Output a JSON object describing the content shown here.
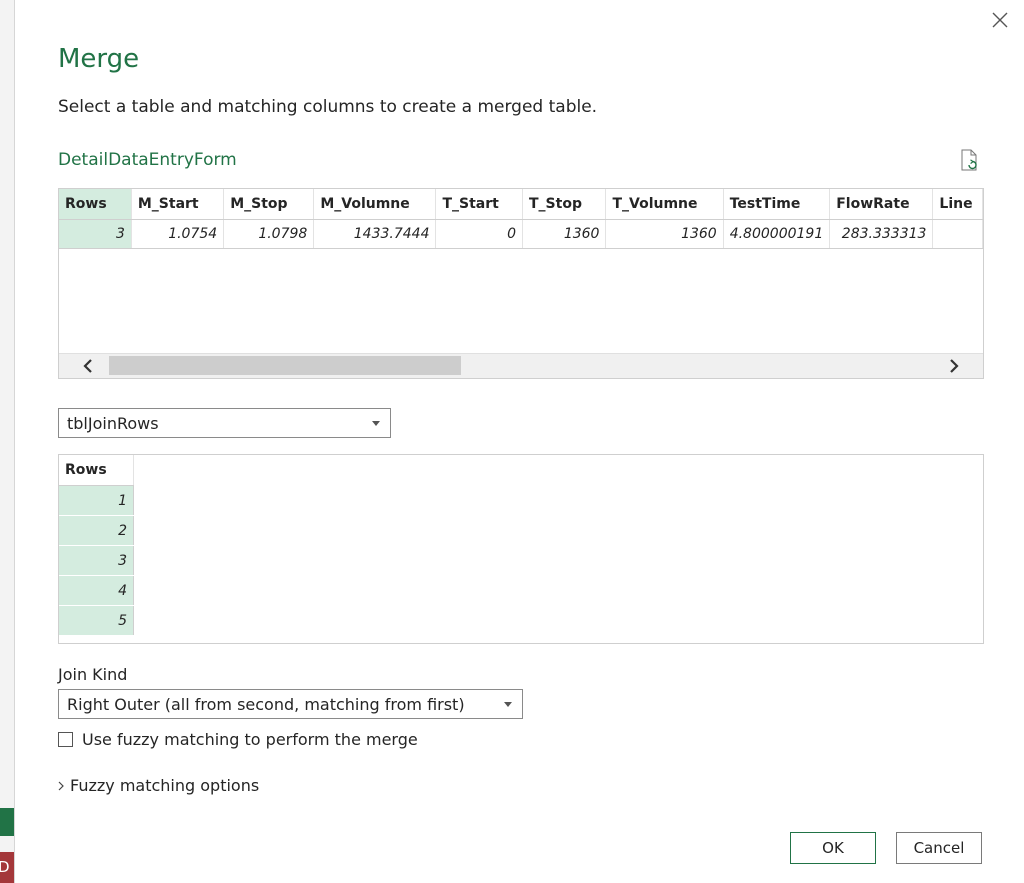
{
  "background": {
    "side_tab_text": "D"
  },
  "dialog": {
    "title": "Merge",
    "subtitle": "Select a table and matching columns to create a merged table.",
    "close_icon": "close-icon",
    "accent_color": "#217346"
  },
  "table1": {
    "name": "DetailDataEntryForm",
    "refresh_icon": "refresh-preview-icon",
    "columns": [
      "Rows",
      "M_Start",
      "M_Stop",
      "M_Volumne",
      "T_Start",
      "T_Stop",
      "T_Volumne",
      "TestTime",
      "FlowRate",
      "Line"
    ],
    "rows": [
      [
        "3",
        "1.0754",
        "1.0798",
        "1433.7444",
        "0",
        "1360",
        "1360",
        "4.800000191",
        "283.333313",
        ""
      ]
    ]
  },
  "table2": {
    "selected": "tblJoinRows",
    "columns": [
      "Rows"
    ],
    "rows": [
      [
        "1"
      ],
      [
        "2"
      ],
      [
        "3"
      ],
      [
        "4"
      ],
      [
        "5"
      ]
    ]
  },
  "join": {
    "label": "Join Kind",
    "selected": "Right Outer (all from second, matching from first)"
  },
  "fuzzy": {
    "checkbox_label": "Use fuzzy matching to perform the merge",
    "checked": false,
    "options_label": "Fuzzy matching options"
  },
  "buttons": {
    "ok": "OK",
    "cancel": "Cancel"
  }
}
